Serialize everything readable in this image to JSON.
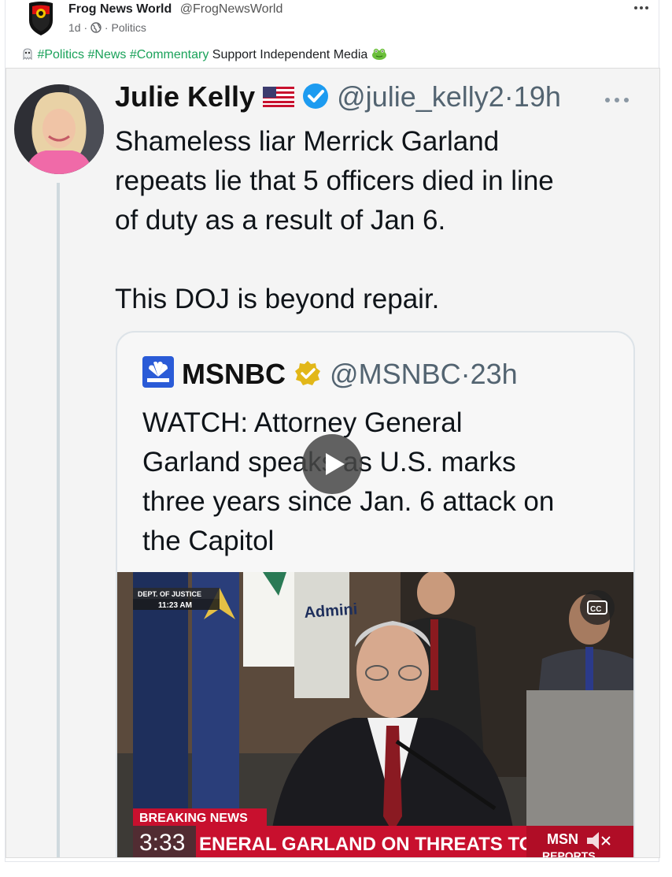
{
  "post": {
    "author_name": "Frog News World",
    "author_handle": "@FrogNewsWorld",
    "age": "1d",
    "sep1": "·",
    "sep2": "·",
    "category": "Politics",
    "more_icon": "more-horizontal-icon",
    "caption": {
      "lead_icon": "ghost-emoji",
      "tags": [
        "#Politics",
        "#News",
        "#Commentary"
      ],
      "text": "Support Independent Media",
      "trail_icon": "frog-emoji"
    }
  },
  "tweet": {
    "name": "Julie Kelly",
    "flag_icon": "us-flag-emoji",
    "verified_icon": "blue-verified-icon",
    "handle": "@julie_kelly2",
    "sep": "·",
    "time": "19h",
    "more_icon": "more-horizontal-icon",
    "text_lines": [
      "Shameless liar Merrick Garland",
      "repeats lie that 5 officers died in line",
      "of duty as a result of Jan 6."
    ],
    "text_2": "This DOJ is beyond repair."
  },
  "quote": {
    "logo_icon": "msnbc-logo",
    "name": "MSNBC",
    "verified_icon": "gold-verified-icon",
    "handle": "@MSNBC",
    "sep": "·",
    "time": "23h",
    "text_lines": [
      "WATCH: Attorney General",
      "Garland speaks as U.S. marks",
      "three years since Jan. 6 attack on",
      "the Capitol"
    ]
  },
  "video": {
    "dept_label": "DEPT. OF JUSTICE",
    "clock": "11:23 AM",
    "flag_text": "Admini",
    "cc_label": "CC",
    "breaking": "BREAKING NEWS",
    "time_bug": "3:33",
    "ticker": "ENERAL GARLAND ON THREATS TO OFFICIALS",
    "network": "MSN",
    "program": "REPORTS",
    "play_icon": "play-icon",
    "mute_icon": "speaker-muted-icon"
  },
  "colors": {
    "hashtag": "#1aa25a",
    "verified_blue": "#1d9bf0",
    "verified_gold": "#e2b719",
    "breaking_red": "#c8102e"
  }
}
